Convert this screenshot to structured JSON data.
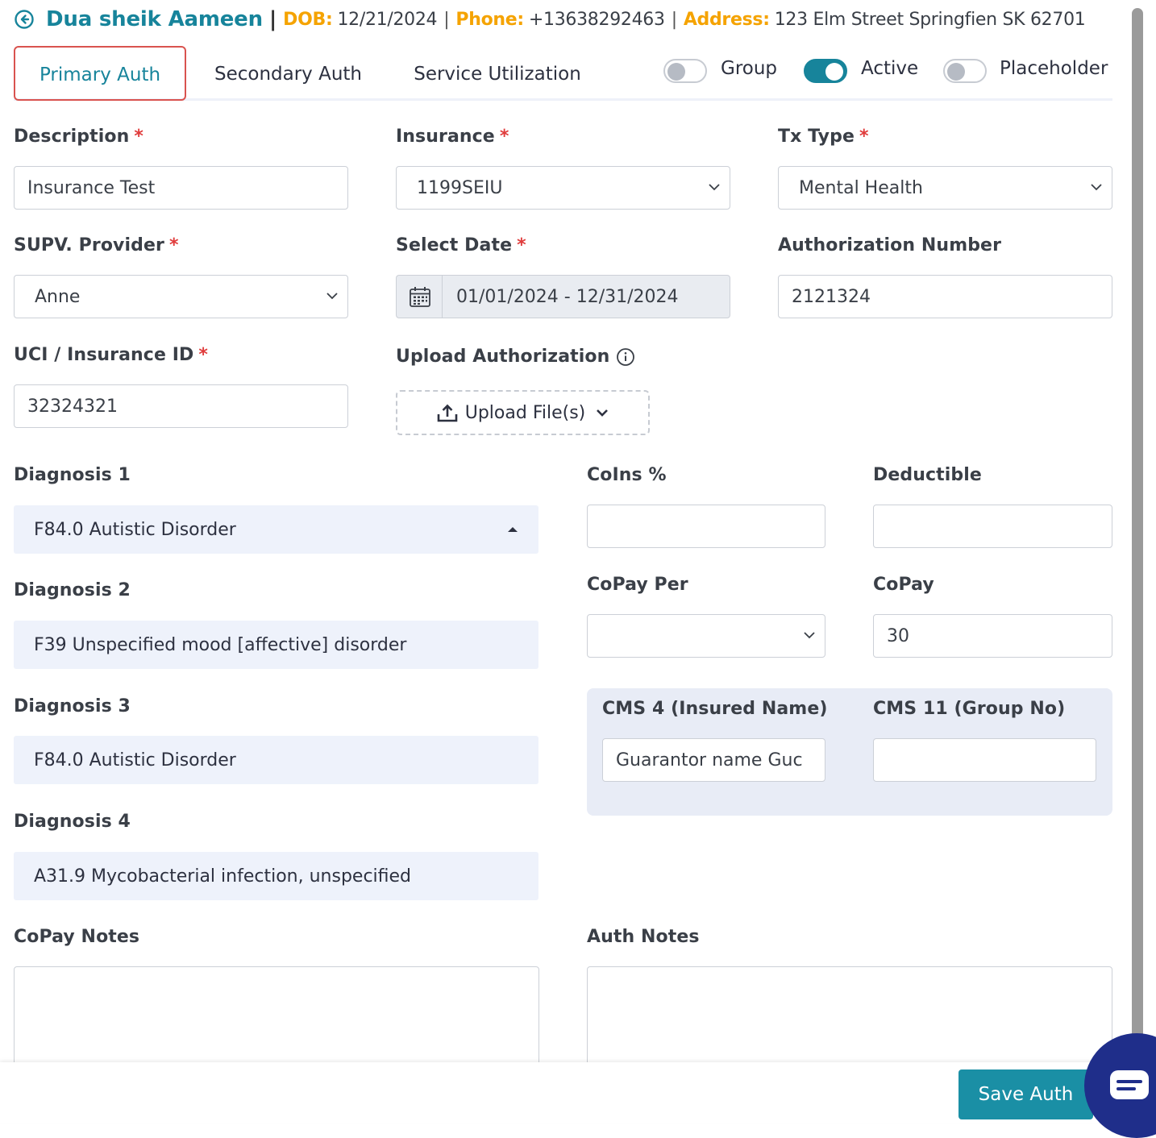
{
  "header": {
    "patient_name": "Dua sheik Aameen",
    "separator": "|",
    "dob_label": "DOB:",
    "dob": "12/21/2024",
    "phone_label": "Phone:",
    "phone": "+13638292463",
    "address_label": "Address:",
    "address": "123 Elm Street Springfien SK 62701"
  },
  "tabs": [
    {
      "label": "Primary Auth",
      "active": true
    },
    {
      "label": "Secondary Auth",
      "active": false
    },
    {
      "label": "Service Utilization",
      "active": false
    }
  ],
  "toggles": [
    {
      "label": "Group",
      "on": false
    },
    {
      "label": "Active",
      "on": true
    },
    {
      "label": "Placeholder",
      "on": false
    }
  ],
  "form": {
    "description": {
      "label": "Description",
      "required": "*",
      "value": "Insurance Test"
    },
    "insurance": {
      "label": "Insurance",
      "required": "*",
      "value": "1199SEIU"
    },
    "tx_type": {
      "label": "Tx Type",
      "required": "*",
      "value": "Mental Health"
    },
    "supv_provider": {
      "label": "SUPV. Provider",
      "required": "*",
      "value": "Anne"
    },
    "select_date": {
      "label": "Select Date",
      "required": "*",
      "value": "01/01/2024 - 12/31/2024"
    },
    "auth_number": {
      "label": "Authorization Number",
      "value": "2121324"
    },
    "uci": {
      "label": "UCI / Insurance ID",
      "required": "*",
      "value": "32324321"
    },
    "upload": {
      "label": "Upload Authorization",
      "button": "Upload File(s)"
    },
    "diagnosis_1": {
      "label": "Diagnosis 1",
      "value": "F84.0 Autistic Disorder"
    },
    "diagnosis_2": {
      "label": "Diagnosis 2",
      "value": "F39 Unspecified mood [affective] disorder"
    },
    "diagnosis_3": {
      "label": "Diagnosis 3",
      "value": "F84.0 Autistic Disorder"
    },
    "diagnosis_4": {
      "label": "Diagnosis 4",
      "value": "A31.9 Mycobacterial infection, unspecified"
    },
    "coins": {
      "label": "CoIns %",
      "value": ""
    },
    "deductible": {
      "label": "Deductible",
      "value": ""
    },
    "copay_per": {
      "label": "CoPay Per",
      "value": ""
    },
    "copay": {
      "label": "CoPay",
      "value": "30"
    },
    "cms4": {
      "label": "CMS 4 (Insured Name)",
      "value": "Guarantor name Guc"
    },
    "cms11": {
      "label": "CMS 11 (Group No)",
      "value": ""
    },
    "copay_notes": {
      "label": "CoPay Notes",
      "value": ""
    },
    "auth_notes": {
      "label": "Auth Notes",
      "value": ""
    }
  },
  "footer": {
    "save_label": "Save Auth"
  },
  "colors": {
    "brand": "#17849b",
    "accent": "#f5a300",
    "required": "#e03c3c",
    "active_tab_border": "#d9534f"
  }
}
